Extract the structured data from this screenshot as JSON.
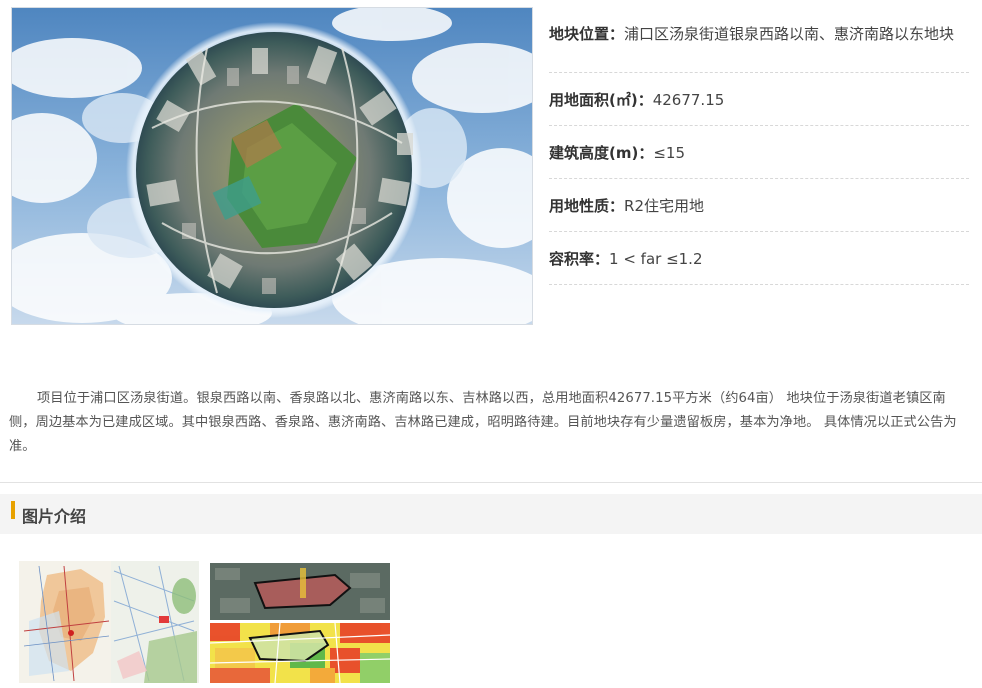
{
  "parcel": {
    "hero_image": "aerial-tiny-planet-panorama",
    "location": {
      "label": "地块位置：",
      "value": "浦口区汤泉街道银泉西路以南、惠济南路以东地块"
    },
    "area": {
      "label": "用地面积(㎡)：",
      "value": "42677.15"
    },
    "height": {
      "label": "建筑高度(m)：",
      "value": "≤15"
    },
    "use": {
      "label": "用地性质：",
      "value": "R2住宅用地"
    },
    "far": {
      "label": "容积率：",
      "value": "1 < far ≤1.2"
    }
  },
  "description": "项目位于浦口区汤泉街道。银泉西路以南、香泉路以北、惠济南路以东、吉林路以西，总用地面积42677.15平方米（约64亩） 地块位于汤泉街道老镇区南侧，周边基本为已建成区域。其中银泉西路、香泉路、惠济南路、吉林路已建成，昭明路待建。目前地块存有少量遗留板房，基本为净地。 具体情况以正式公告为准。",
  "gallery": {
    "title": "图片介绍",
    "images": [
      "location-map-thumbnail",
      "satellite-and-zoning-map-thumbnail"
    ]
  },
  "colors": {
    "accent": "#e8a200",
    "sky": "#5f93c8",
    "green": "#4a8a3a"
  }
}
